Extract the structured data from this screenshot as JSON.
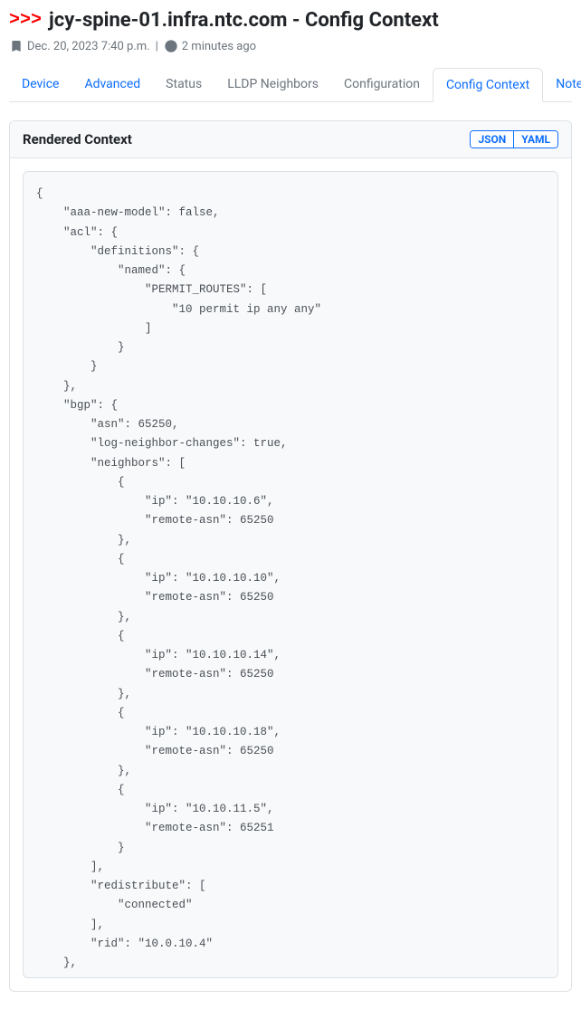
{
  "header": {
    "prompt": ">>>",
    "title": "jcy-spine-01.infra.ntc.com - Config Context"
  },
  "meta": {
    "date": "Dec. 20, 2023 7:40 p.m.",
    "separator": "|",
    "relative": "2 minutes ago"
  },
  "tabs": [
    {
      "label": "Device",
      "state": "link"
    },
    {
      "label": "Advanced",
      "state": "link"
    },
    {
      "label": "Status",
      "state": "muted"
    },
    {
      "label": "LLDP Neighbors",
      "state": "muted"
    },
    {
      "label": "Configuration",
      "state": "muted"
    },
    {
      "label": "Config Context",
      "state": "active"
    },
    {
      "label": "Notes",
      "state": "link"
    }
  ],
  "card": {
    "title": "Rendered Context",
    "buttons": {
      "json": "JSON",
      "yaml": "YAML"
    }
  },
  "code": "{\n    \"aaa-new-model\": false,\n    \"acl\": {\n        \"definitions\": {\n            \"named\": {\n                \"PERMIT_ROUTES\": [\n                    \"10 permit ip any any\"\n                ]\n            }\n        }\n    },\n    \"bgp\": {\n        \"asn\": 65250,\n        \"log-neighbor-changes\": true,\n        \"neighbors\": [\n            {\n                \"ip\": \"10.10.10.6\",\n                \"remote-asn\": 65250\n            },\n            {\n                \"ip\": \"10.10.10.10\",\n                \"remote-asn\": 65250\n            },\n            {\n                \"ip\": \"10.10.10.14\",\n                \"remote-asn\": 65250\n            },\n            {\n                \"ip\": \"10.10.10.18\",\n                \"remote-asn\": 65250\n            },\n            {\n                \"ip\": \"10.10.11.5\",\n                \"remote-asn\": 65251\n            }\n        ],\n        \"redistribute\": [\n            \"connected\"\n        ],\n        \"rid\": \"10.0.10.4\"\n    },"
}
